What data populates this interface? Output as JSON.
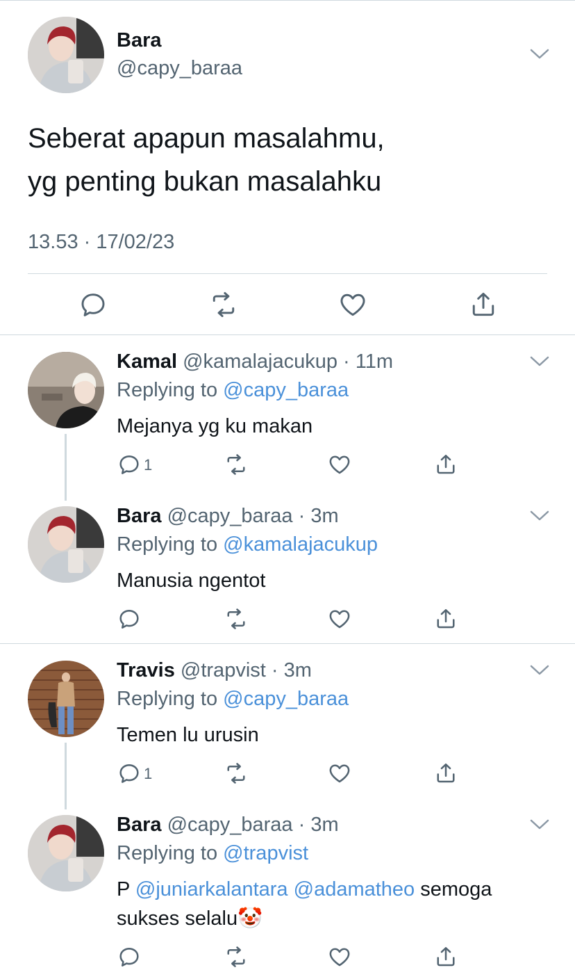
{
  "main": {
    "name": "Bara",
    "handle": "@capy_baraa",
    "text": "Seberat apapun masalahmu,\nyg penting bukan masalahku",
    "timestamp": "13.53 · 17/02/23"
  },
  "replies": [
    {
      "name": "Kamal",
      "handle": "@kamalajacukup",
      "time": "11m",
      "replying_prefix": "Replying to ",
      "replying_to": "@capy_baraa",
      "text": "Mejanya yg ku makan",
      "reply_count": "1"
    },
    {
      "name": "Bara",
      "handle": "@capy_baraa",
      "time": "3m",
      "replying_prefix": "Replying to ",
      "replying_to": "@kamalajacukup",
      "text": "Manusia ngentot",
      "reply_count": ""
    },
    {
      "name": "Travis",
      "handle": "@trapvist",
      "time": "3m",
      "replying_prefix": "Replying to ",
      "replying_to": "@capy_baraa",
      "text": "Temen lu urusin",
      "reply_count": "1"
    },
    {
      "name": "Bara",
      "handle": "@capy_baraa",
      "time": "3m",
      "replying_prefix": "Replying to ",
      "replying_to": "@trapvist",
      "text_prefix": "P ",
      "mention1": "@juniarkalantara",
      "mention2": "@adamatheo",
      "text_after": " semoga",
      "text_line2": "sukses selalu",
      "emoji": "🤡",
      "reply_count": ""
    }
  ],
  "separator": " · ",
  "colors": {
    "link": "#4a90d9",
    "secondary": "#536471",
    "divider": "#cfd9de"
  }
}
